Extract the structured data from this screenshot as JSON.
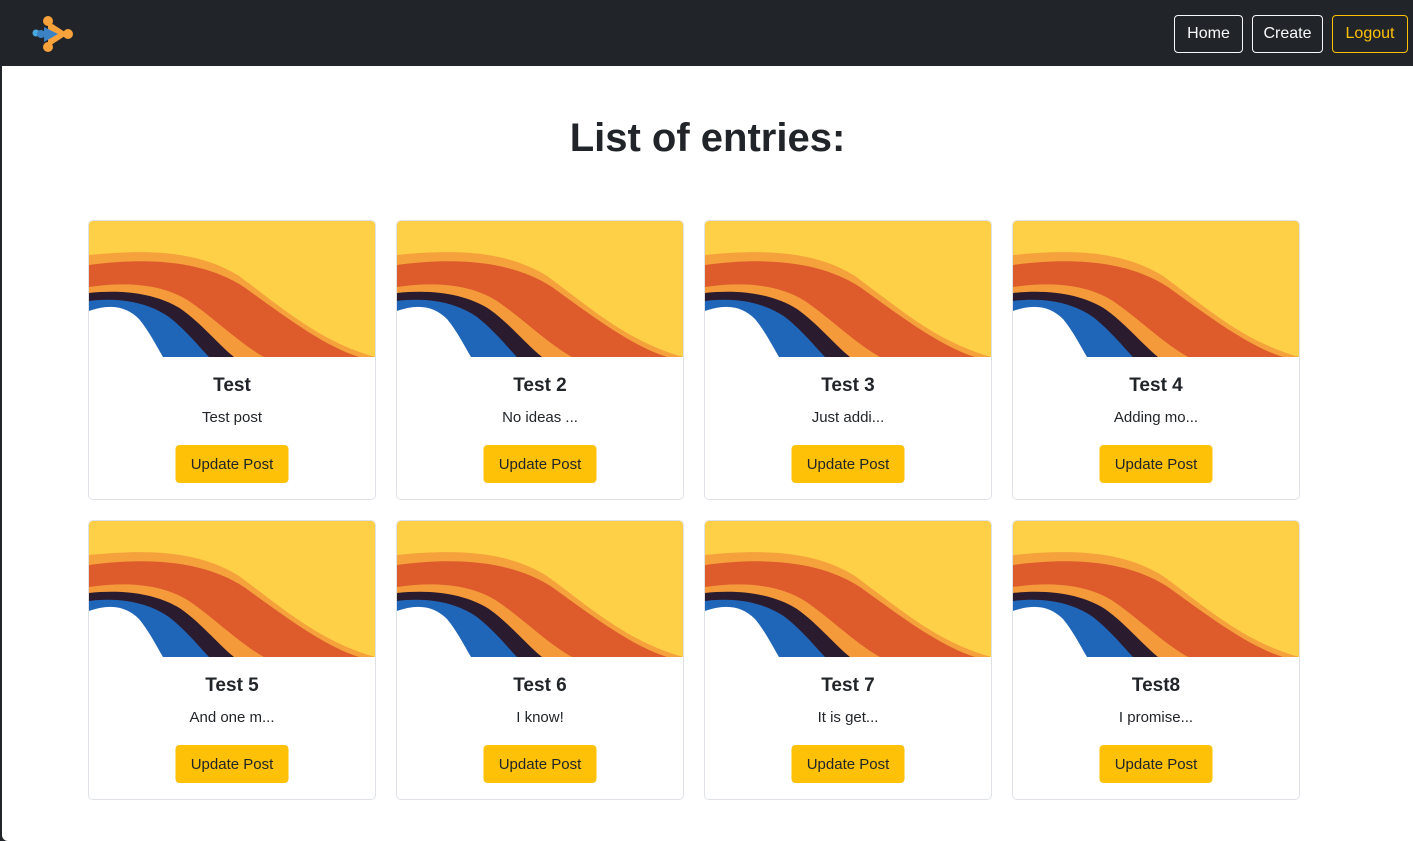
{
  "navbar": {
    "logo_icon": "play-molecule-logo-icon",
    "buttons": [
      {
        "label": "Home"
      },
      {
        "label": "Create"
      },
      {
        "label": "Logout"
      }
    ]
  },
  "main": {
    "title": "List of entries:",
    "cards": [
      {
        "title": "Test",
        "text": "Test post",
        "button": "Update Post"
      },
      {
        "title": "Test 2",
        "text": "No ideas ...",
        "button": "Update Post"
      },
      {
        "title": "Test 3",
        "text": "Just addi...",
        "button": "Update Post"
      },
      {
        "title": "Test 4",
        "text": "Adding mo...",
        "button": "Update Post"
      },
      {
        "title": "Test 5",
        "text": "And one m...",
        "button": "Update Post"
      },
      {
        "title": "Test 6",
        "text": "I know!",
        "button": "Update Post"
      },
      {
        "title": "Test 7",
        "text": "It is get...",
        "button": "Update Post"
      },
      {
        "title": "Test8",
        "text": "I promise...",
        "button": "Update Post"
      }
    ]
  },
  "colors": {
    "navbar_bg": "#212529",
    "accent": "#ffc107",
    "card_border": "#dee2e6"
  }
}
